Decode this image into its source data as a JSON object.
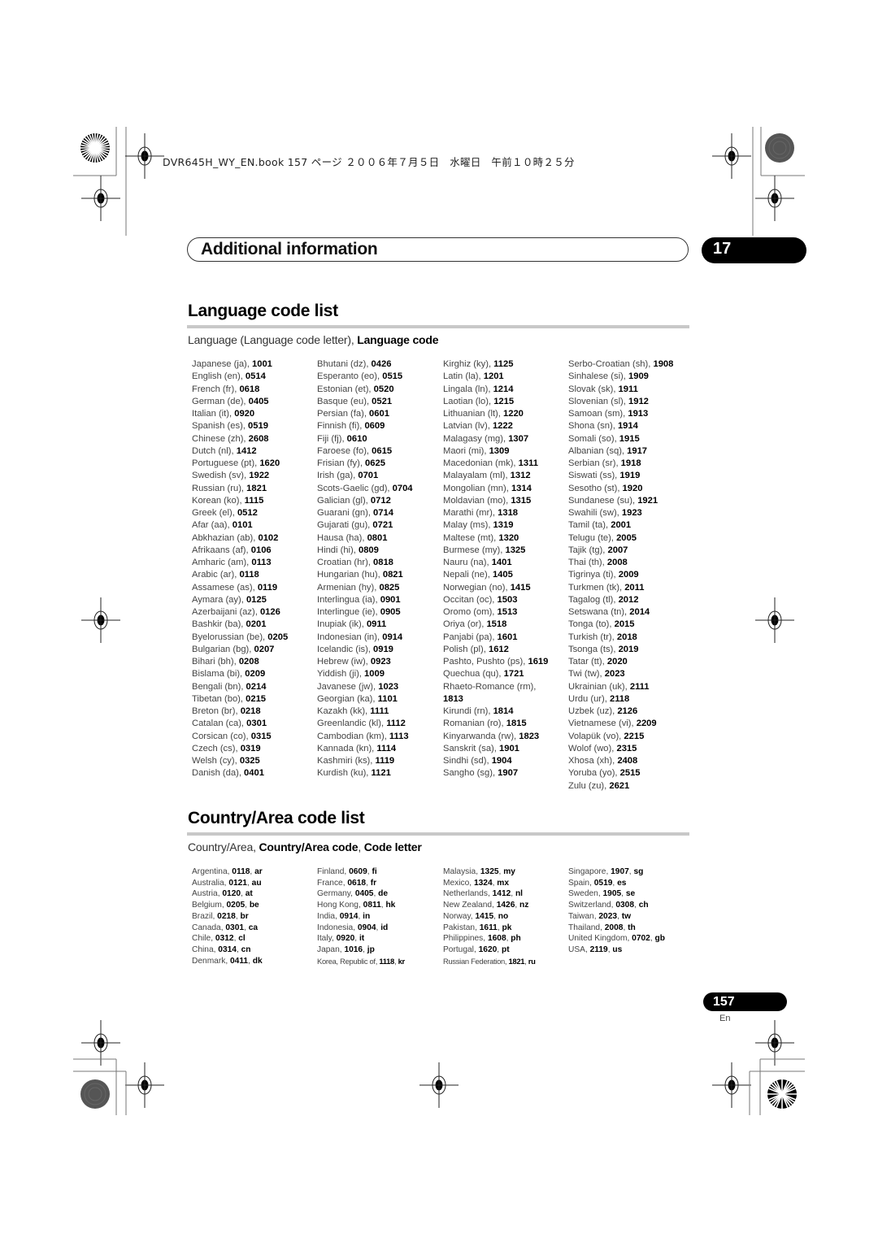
{
  "book_info": "DVR645H_WY_EN.book  157 ページ  ２００６年７月５日　水曜日　午前１０時２５分",
  "chapter": {
    "title": "Additional information",
    "number": "17"
  },
  "language_section": {
    "title": "Language code list",
    "subtitle_plain": "Language (Language code letter), ",
    "subtitle_bold": "Language code",
    "columns": [
      [
        {
          "name": "Japanese (ja), ",
          "code": "1001"
        },
        {
          "name": "English (en), ",
          "code": "0514"
        },
        {
          "name": "French (fr), ",
          "code": "0618"
        },
        {
          "name": "German (de), ",
          "code": "0405"
        },
        {
          "name": "Italian (it), ",
          "code": "0920"
        },
        {
          "name": "Spanish (es), ",
          "code": "0519"
        },
        {
          "name": "Chinese (zh), ",
          "code": "2608"
        },
        {
          "name": "Dutch (nl), ",
          "code": "1412"
        },
        {
          "name": "Portuguese (pt), ",
          "code": "1620"
        },
        {
          "name": "Swedish (sv), ",
          "code": "1922"
        },
        {
          "name": "Russian (ru), ",
          "code": "1821"
        },
        {
          "name": "Korean (ko), ",
          "code": "1115"
        },
        {
          "name": "Greek (el), ",
          "code": "0512"
        },
        {
          "name": "Afar (aa), ",
          "code": "0101"
        },
        {
          "name": "Abkhazian (ab), ",
          "code": "0102"
        },
        {
          "name": "Afrikaans (af), ",
          "code": "0106"
        },
        {
          "name": "Amharic (am), ",
          "code": "0113"
        },
        {
          "name": "Arabic (ar), ",
          "code": "0118"
        },
        {
          "name": "Assamese (as), ",
          "code": "0119"
        },
        {
          "name": "Aymara (ay), ",
          "code": "0125"
        },
        {
          "name": "Azerbaijani (az), ",
          "code": "0126"
        },
        {
          "name": "Bashkir (ba), ",
          "code": "0201"
        },
        {
          "name": "Byelorussian (be), ",
          "code": "0205"
        },
        {
          "name": "Bulgarian (bg), ",
          "code": "0207"
        },
        {
          "name": "Bihari (bh), ",
          "code": "0208"
        },
        {
          "name": "Bislama (bi), ",
          "code": "0209"
        },
        {
          "name": "Bengali (bn), ",
          "code": "0214"
        },
        {
          "name": "Tibetan (bo), ",
          "code": "0215"
        },
        {
          "name": "Breton (br), ",
          "code": "0218"
        },
        {
          "name": "Catalan (ca), ",
          "code": "0301"
        },
        {
          "name": "Corsican (co), ",
          "code": "0315"
        },
        {
          "name": "Czech (cs), ",
          "code": "0319"
        },
        {
          "name": "Welsh (cy), ",
          "code": "0325"
        },
        {
          "name": "Danish (da), ",
          "code": "0401"
        }
      ],
      [
        {
          "name": "Bhutani (dz), ",
          "code": "0426"
        },
        {
          "name": "Esperanto (eo), ",
          "code": "0515"
        },
        {
          "name": "Estonian (et), ",
          "code": "0520"
        },
        {
          "name": "Basque (eu), ",
          "code": "0521"
        },
        {
          "name": "Persian (fa), ",
          "code": "0601"
        },
        {
          "name": "Finnish (fi), ",
          "code": "0609"
        },
        {
          "name": "Fiji (fj), ",
          "code": "0610"
        },
        {
          "name": "Faroese (fo), ",
          "code": "0615"
        },
        {
          "name": "Frisian (fy), ",
          "code": "0625"
        },
        {
          "name": "Irish (ga), ",
          "code": "0701"
        },
        {
          "name": "Scots-Gaelic (gd), ",
          "code": "0704"
        },
        {
          "name": "Galician (gl), ",
          "code": "0712"
        },
        {
          "name": "Guarani (gn), ",
          "code": "0714"
        },
        {
          "name": "Gujarati (gu), ",
          "code": "0721"
        },
        {
          "name": "Hausa (ha), ",
          "code": "0801"
        },
        {
          "name": "Hindi (hi), ",
          "code": "0809"
        },
        {
          "name": "Croatian (hr), ",
          "code": "0818"
        },
        {
          "name": "Hungarian (hu), ",
          "code": "0821"
        },
        {
          "name": "Armenian (hy), ",
          "code": "0825"
        },
        {
          "name": "Interlingua (ia), ",
          "code": "0901"
        },
        {
          "name": "Interlingue (ie), ",
          "code": "0905"
        },
        {
          "name": "Inupiak (ik), ",
          "code": "0911"
        },
        {
          "name": "Indonesian (in), ",
          "code": "0914"
        },
        {
          "name": "Icelandic (is), ",
          "code": "0919"
        },
        {
          "name": "Hebrew (iw), ",
          "code": "0923"
        },
        {
          "name": "Yiddish (ji), ",
          "code": "1009"
        },
        {
          "name": "Javanese (jw), ",
          "code": "1023"
        },
        {
          "name": "Georgian (ka), ",
          "code": "1101"
        },
        {
          "name": "Kazakh (kk), ",
          "code": "1111"
        },
        {
          "name": "Greenlandic (kl), ",
          "code": "1112"
        },
        {
          "name": "Cambodian (km), ",
          "code": "1113"
        },
        {
          "name": "Kannada (kn), ",
          "code": "1114"
        },
        {
          "name": "Kashmiri (ks), ",
          "code": "1119"
        },
        {
          "name": "Kurdish (ku), ",
          "code": "1121"
        }
      ],
      [
        {
          "name": "Kirghiz (ky), ",
          "code": "1125"
        },
        {
          "name": "Latin (la), ",
          "code": "1201"
        },
        {
          "name": "Lingala (ln), ",
          "code": "1214"
        },
        {
          "name": "Laotian (lo), ",
          "code": "1215"
        },
        {
          "name": "Lithuanian (lt), ",
          "code": "1220"
        },
        {
          "name": "Latvian (lv), ",
          "code": "1222"
        },
        {
          "name": "Malagasy (mg), ",
          "code": "1307"
        },
        {
          "name": "Maori (mi), ",
          "code": "1309"
        },
        {
          "name": "Macedonian (mk), ",
          "code": "1311"
        },
        {
          "name": "Malayalam (ml), ",
          "code": "1312"
        },
        {
          "name": "Mongolian (mn), ",
          "code": "1314"
        },
        {
          "name": "Moldavian (mo), ",
          "code": "1315"
        },
        {
          "name": "Marathi (mr), ",
          "code": "1318"
        },
        {
          "name": "Malay (ms), ",
          "code": "1319"
        },
        {
          "name": "Maltese (mt), ",
          "code": "1320"
        },
        {
          "name": "Burmese (my), ",
          "code": "1325"
        },
        {
          "name": "Nauru (na), ",
          "code": "1401"
        },
        {
          "name": "Nepali (ne), ",
          "code": "1405"
        },
        {
          "name": "Norwegian (no), ",
          "code": "1415"
        },
        {
          "name": "Occitan (oc), ",
          "code": "1503"
        },
        {
          "name": "Oromo (om), ",
          "code": "1513"
        },
        {
          "name": "Oriya (or), ",
          "code": "1518"
        },
        {
          "name": "Panjabi (pa), ",
          "code": "1601"
        },
        {
          "name": "Polish (pl), ",
          "code": "1612"
        },
        {
          "name": "Pashto, Pushto (ps), ",
          "code": "1619"
        },
        {
          "name": "Quechua (qu), ",
          "code": "1721"
        },
        {
          "name": "Rhaeto-Romance (rm),",
          "code": ""
        },
        {
          "name": "",
          "code": "1813"
        },
        {
          "name": "Kirundi (rn), ",
          "code": "1814"
        },
        {
          "name": "Romanian (ro), ",
          "code": "1815"
        },
        {
          "name": "Kinyarwanda (rw), ",
          "code": "1823"
        },
        {
          "name": "Sanskrit (sa), ",
          "code": "1901"
        },
        {
          "name": "Sindhi (sd), ",
          "code": "1904"
        },
        {
          "name": "Sangho (sg), ",
          "code": "1907"
        }
      ],
      [
        {
          "name": "Serbo-Croatian (sh), ",
          "code": "1908"
        },
        {
          "name": "Sinhalese (si), ",
          "code": "1909"
        },
        {
          "name": "Slovak (sk), ",
          "code": "1911"
        },
        {
          "name": "Slovenian (sl), ",
          "code": "1912"
        },
        {
          "name": "Samoan (sm), ",
          "code": "1913"
        },
        {
          "name": "Shona (sn), ",
          "code": "1914"
        },
        {
          "name": "Somali (so), ",
          "code": "1915"
        },
        {
          "name": "Albanian (sq), ",
          "code": "1917"
        },
        {
          "name": "Serbian (sr), ",
          "code": "1918"
        },
        {
          "name": "Siswati (ss), ",
          "code": "1919"
        },
        {
          "name": "Sesotho (st), ",
          "code": "1920"
        },
        {
          "name": "Sundanese (su), ",
          "code": "1921"
        },
        {
          "name": "Swahili (sw), ",
          "code": "1923"
        },
        {
          "name": "Tamil (ta), ",
          "code": "2001"
        },
        {
          "name": "Telugu (te), ",
          "code": "2005"
        },
        {
          "name": "Tajik (tg), ",
          "code": "2007"
        },
        {
          "name": "Thai (th), ",
          "code": "2008"
        },
        {
          "name": "Tigrinya (ti), ",
          "code": "2009"
        },
        {
          "name": "Turkmen (tk), ",
          "code": "2011"
        },
        {
          "name": "Tagalog (tl), ",
          "code": "2012"
        },
        {
          "name": "Setswana (tn), ",
          "code": "2014"
        },
        {
          "name": "Tonga (to), ",
          "code": "2015"
        },
        {
          "name": "Turkish (tr), ",
          "code": "2018"
        },
        {
          "name": "Tsonga (ts), ",
          "code": "2019"
        },
        {
          "name": "Tatar (tt), ",
          "code": "2020"
        },
        {
          "name": "Twi (tw), ",
          "code": "2023"
        },
        {
          "name": "Ukrainian (uk), ",
          "code": "2111"
        },
        {
          "name": "Urdu (ur), ",
          "code": "2118"
        },
        {
          "name": "Uzbek (uz), ",
          "code": "2126"
        },
        {
          "name": "Vietnamese (vi), ",
          "code": "2209"
        },
        {
          "name": "Volapük (vo), ",
          "code": "2215"
        },
        {
          "name": "Wolof (wo), ",
          "code": "2315"
        },
        {
          "name": "Xhosa (xh), ",
          "code": "2408"
        },
        {
          "name": "Yoruba (yo), ",
          "code": "2515"
        },
        {
          "name": "Zulu (zu), ",
          "code": "2621"
        }
      ]
    ]
  },
  "country_section": {
    "title": "Country/Area code list",
    "subtitle_plain": "Country/Area, ",
    "subtitle_bold1": "Country/Area code",
    "subtitle_sep": ", ",
    "subtitle_bold2": "Code letter",
    "columns": [
      [
        {
          "name": "Argentina",
          "code": "0118",
          "letter": "ar"
        },
        {
          "name": "Australia",
          "code": "0121",
          "letter": "au"
        },
        {
          "name": "Austria",
          "code": "0120",
          "letter": "at"
        },
        {
          "name": "Belgium",
          "code": "0205",
          "letter": "be"
        },
        {
          "name": "Brazil",
          "code": "0218",
          "letter": "br"
        },
        {
          "name": "Canada",
          "code": "0301",
          "letter": "ca"
        },
        {
          "name": "Chile",
          "code": "0312",
          "letter": "cl"
        },
        {
          "name": "China",
          "code": "0314",
          "letter": "cn"
        },
        {
          "name": "Denmark",
          "code": "0411",
          "letter": "dk"
        }
      ],
      [
        {
          "name": "Finland",
          "code": "0609",
          "letter": "fi"
        },
        {
          "name": "France",
          "code": "0618",
          "letter": "fr"
        },
        {
          "name": "Germany",
          "code": "0405",
          "letter": "de"
        },
        {
          "name": "Hong Kong",
          "code": "0811",
          "letter": "hk"
        },
        {
          "name": "India",
          "code": "0914",
          "letter": "in"
        },
        {
          "name": "Indonesia",
          "code": "0904",
          "letter": "id"
        },
        {
          "name": "Italy",
          "code": "0920",
          "letter": "it"
        },
        {
          "name": "Japan",
          "code": "1016",
          "letter": "jp"
        },
        {
          "name": "Korea, Republic of",
          "code": "1118",
          "letter": "kr"
        }
      ],
      [
        {
          "name": "Malaysia",
          "code": "1325",
          "letter": "my"
        },
        {
          "name": "Mexico",
          "code": "1324",
          "letter": "mx"
        },
        {
          "name": "Netherlands",
          "code": "1412",
          "letter": "nl"
        },
        {
          "name": "New Zealand",
          "code": "1426",
          "letter": "nz"
        },
        {
          "name": "Norway",
          "code": "1415",
          "letter": "no"
        },
        {
          "name": "Pakistan",
          "code": "1611",
          "letter": "pk"
        },
        {
          "name": "Philippines",
          "code": "1608",
          "letter": "ph"
        },
        {
          "name": "Portugal",
          "code": "1620",
          "letter": "pt"
        },
        {
          "name": "Russian Federation",
          "code": "1821",
          "letter": "ru"
        }
      ],
      [
        {
          "name": "Singapore",
          "code": "1907",
          "letter": "sg"
        },
        {
          "name": "Spain",
          "code": "0519",
          "letter": "es"
        },
        {
          "name": "Sweden",
          "code": "1905",
          "letter": "se"
        },
        {
          "name": "Switzerland",
          "code": "0308",
          "letter": "ch"
        },
        {
          "name": "Taiwan",
          "code": "2023",
          "letter": "tw"
        },
        {
          "name": "Thailand",
          "code": "2008",
          "letter": "th"
        },
        {
          "name": "United Kingdom",
          "code": "0702",
          "letter": "gb"
        },
        {
          "name": "USA",
          "code": "2119",
          "letter": "us"
        }
      ]
    ]
  },
  "footer": {
    "page_number": "157",
    "language": "En"
  },
  "icons": {
    "registration_mark": "crosshair-circle-icon",
    "starburst": "starburst-target-icon",
    "gray_disc": "gray-disc-target-icon"
  }
}
